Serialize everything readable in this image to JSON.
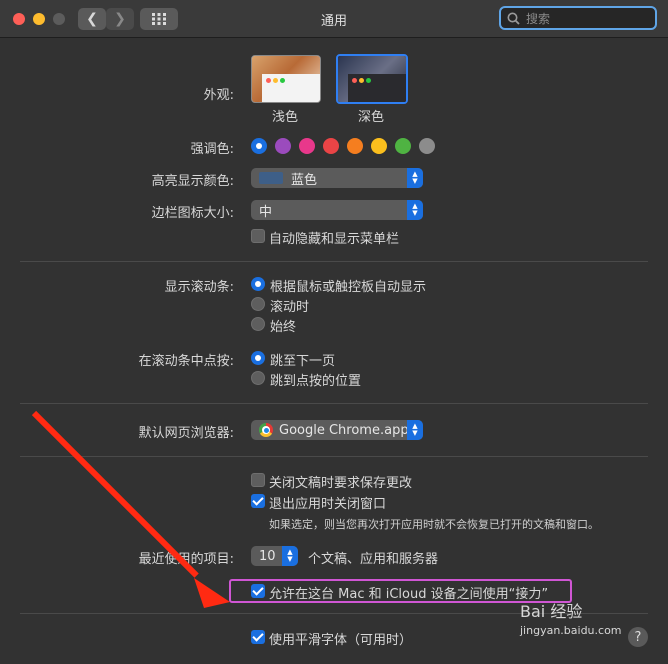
{
  "window": {
    "title": "通用"
  },
  "search": {
    "placeholder": "搜索"
  },
  "appearance": {
    "label": "外观:",
    "options": [
      {
        "label": "浅色",
        "selected": false
      },
      {
        "label": "深色",
        "selected": true
      }
    ]
  },
  "accent": {
    "label": "强调色:",
    "colors": [
      "#1a6fe0",
      "#9b4bbd",
      "#e8388b",
      "#ea4446",
      "#f57e1f",
      "#fbbf1d",
      "#4fb342",
      "#8c8c8c"
    ],
    "selected_index": 0
  },
  "highlight_color": {
    "label": "高亮显示颜色:",
    "value": "蓝色",
    "swatch": "#3e5f88"
  },
  "sidebar_icon_size": {
    "label": "边栏图标大小:",
    "value": "中"
  },
  "auto_hide_menubar": {
    "label": "自动隐藏和显示菜单栏",
    "checked": false
  },
  "show_scrollbars": {
    "label": "显示滚动条:",
    "options": [
      "根据鼠标或触控板自动显示",
      "滚动时",
      "始终"
    ],
    "selected_index": 0
  },
  "click_scrollbar": {
    "label": "在滚动条中点按:",
    "options": [
      "跳至下一页",
      "跳到点按的位置"
    ],
    "selected_index": 0
  },
  "default_browser": {
    "label": "默认网页浏览器:",
    "value": "Google Chrome.app"
  },
  "ask_keep_changes": {
    "label": "关闭文稿时要求保存更改",
    "checked": false
  },
  "close_windows": {
    "label": "退出应用时关闭窗口",
    "checked": true,
    "note": "如果选定，则当您再次打开应用时就不会恢复已打开的文稿和窗口。"
  },
  "recent_items": {
    "label": "最近使用的项目:",
    "value": "10",
    "suffix": "个文稿、应用和服务器"
  },
  "handoff": {
    "label": "允许在这台 Mac 和 iCloud 设备之间使用“接力”",
    "checked": true
  },
  "font_smoothing": {
    "label": "使用平滑字体（可用时）",
    "checked": true
  },
  "help": {
    "label": "?"
  },
  "watermark": {
    "brand": "Bai 经验",
    "url": "jingyan.baidu.com"
  }
}
